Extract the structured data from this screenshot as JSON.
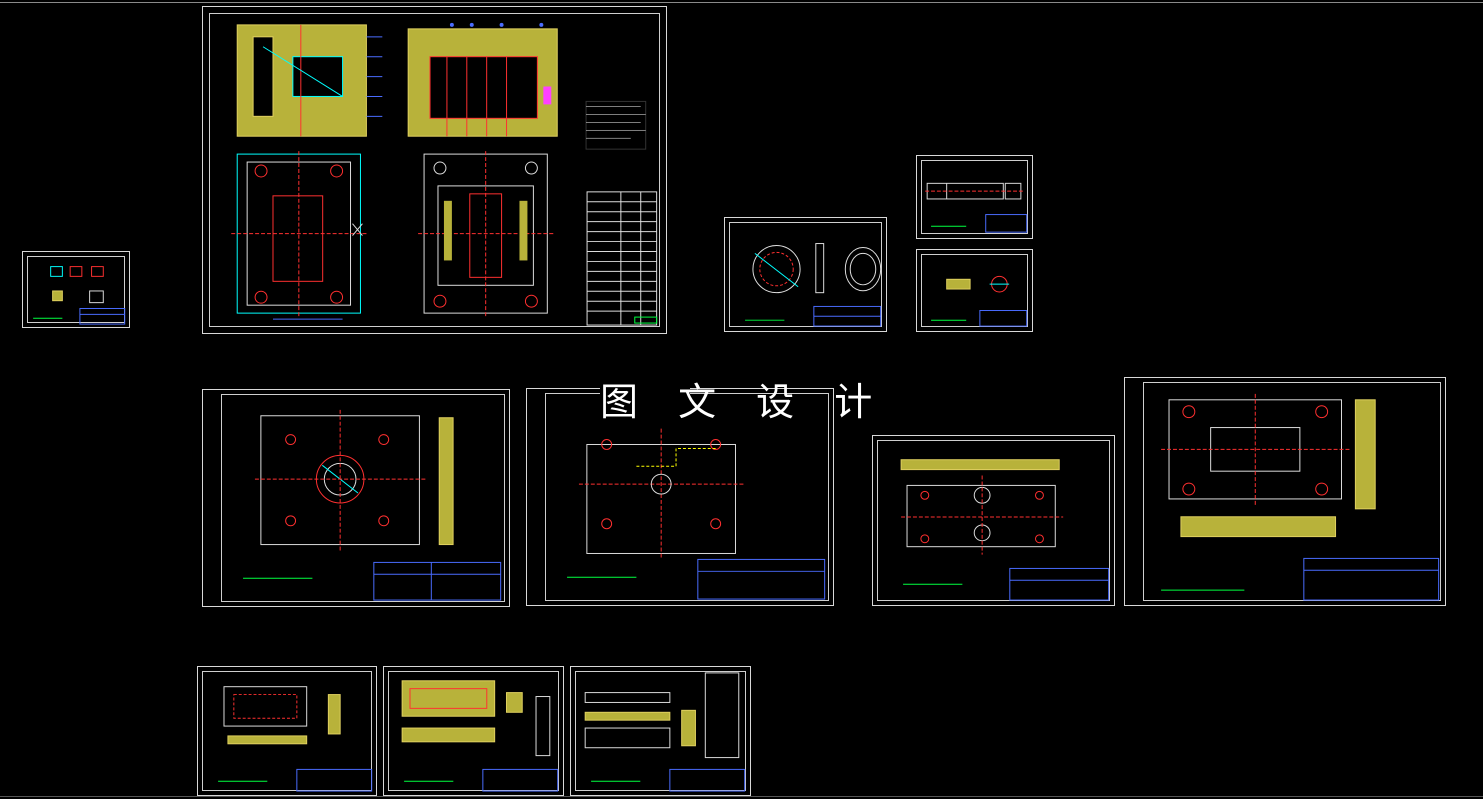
{
  "watermark": {
    "text": "图 文 设 计"
  },
  "colors": {
    "background": "#000000",
    "frame": "#d8d8d8",
    "section": "#b8b23a",
    "hatch": "#e0d060",
    "red": "#ff3030",
    "cyan": "#00ffff",
    "green": "#00ff40",
    "yellow": "#ffff00",
    "blue": "#4a6cff",
    "magenta": "#ff40ff"
  },
  "sheets": [
    {
      "id": "sheet-thumb-left",
      "kind": "thumb"
    },
    {
      "id": "sheet-assembly",
      "kind": "assembly"
    },
    {
      "id": "sheet-ring",
      "kind": "ring"
    },
    {
      "id": "sheet-rod",
      "kind": "rod"
    },
    {
      "id": "sheet-pin",
      "kind": "pin"
    },
    {
      "id": "sheet-plate-1",
      "kind": "plate"
    },
    {
      "id": "sheet-plate-2",
      "kind": "plate"
    },
    {
      "id": "sheet-plate-3",
      "kind": "plate"
    },
    {
      "id": "sheet-plate-4",
      "kind": "plate"
    },
    {
      "id": "sheet-cavity-1",
      "kind": "cavity"
    },
    {
      "id": "sheet-cavity-2",
      "kind": "cavity"
    },
    {
      "id": "sheet-cavity-3",
      "kind": "cavity"
    }
  ]
}
